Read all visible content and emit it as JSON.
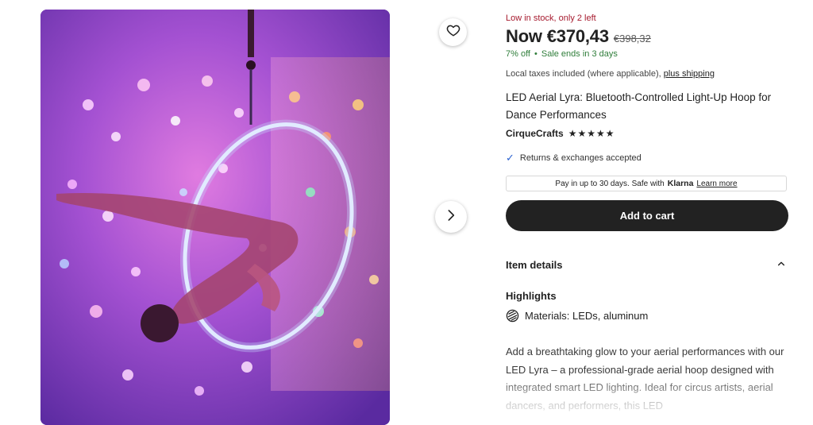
{
  "listing": {
    "stock_notice": "Low in stock, only 2 left",
    "price_now": "Now €370,43",
    "price_was": "€398,32",
    "discount": "7% off",
    "sale_ends": "Sale ends in 3 days",
    "taxes_text": "Local taxes included (where applicable),",
    "shipping_link": "plus shipping",
    "title": "LED Aerial Lyra: Bluetooth-Controlled Light-Up Hoop for Dance Performances",
    "shop_name": "CirqueCrafts",
    "rating_stars": "★★★★★",
    "returns_text": "Returns & exchanges accepted",
    "klarna_text": "Pay in up to 30 days. Safe with",
    "klarna_brand": "Klarna",
    "klarna_link": "Learn more",
    "add_to_cart": "Add to cart"
  },
  "details": {
    "section_label": "Item details",
    "highlights_label": "Highlights",
    "materials_text": "Materials: LEDs, aluminum",
    "description": "Add a breathtaking glow to your aerial performances with our LED Lyra – a professional-grade aerial hoop designed with integrated smart LED lighting. Ideal for circus artists, aerial dancers, and performers, this LED"
  },
  "icons": {
    "favorite": "heart-icon",
    "next_image": "chevron-right-icon",
    "returns": "checkmark-icon",
    "materials": "materials-icon",
    "collapse": "chevron-up-icon"
  },
  "colors": {
    "stock_red": "#a61a2e",
    "sale_green": "#2f7d3a",
    "cart_button": "#222222",
    "returns_check": "#2b62d0"
  }
}
